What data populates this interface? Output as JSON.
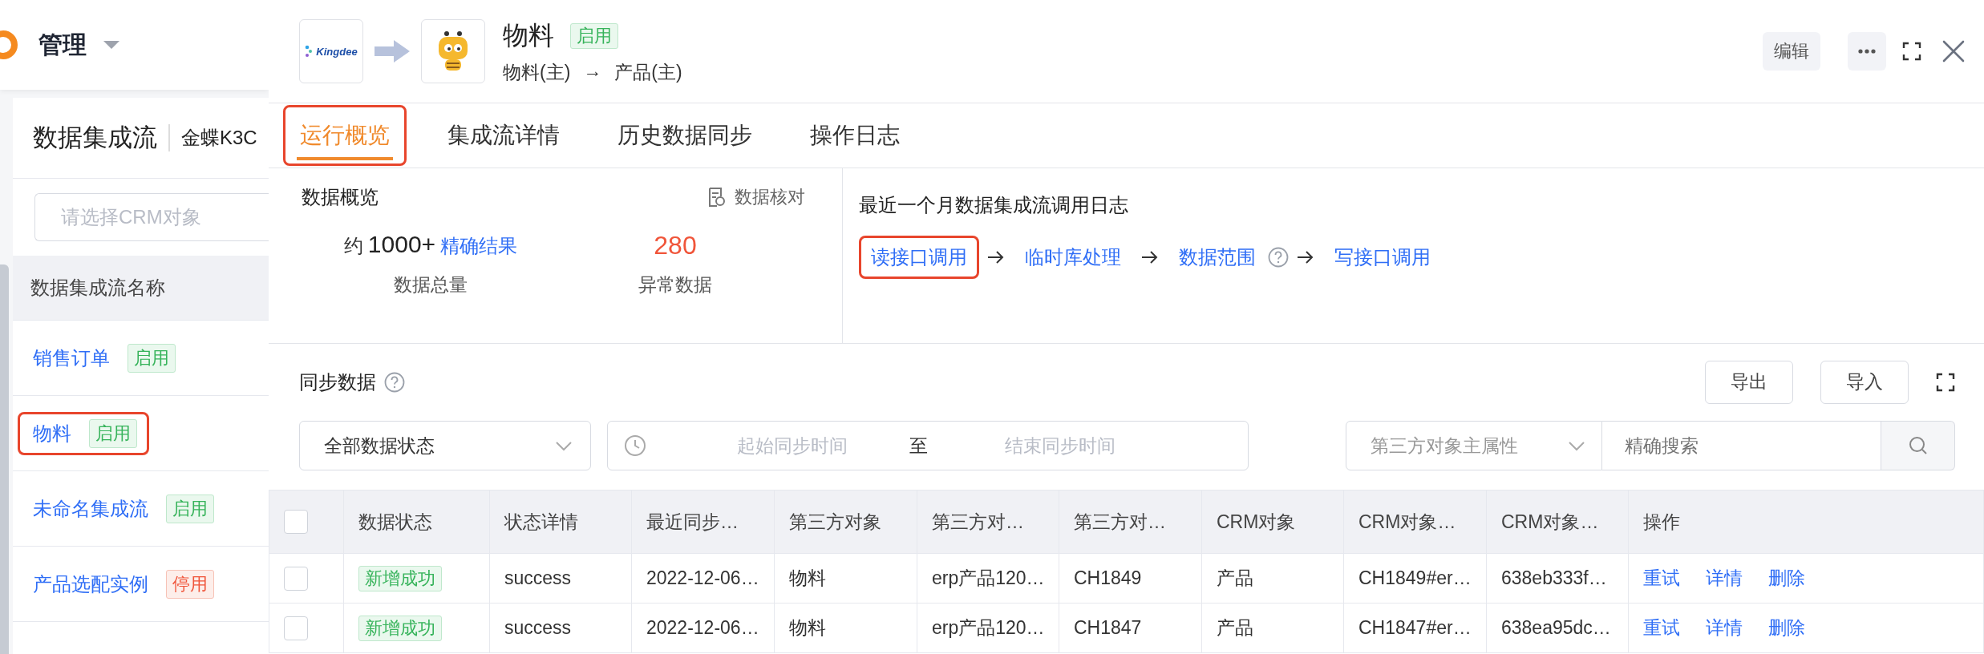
{
  "sidebar": {
    "app_title": "管理",
    "title": "数据集成流",
    "subtitle": "金蝶K3C",
    "search": {
      "placeholder": "请选择CRM对象"
    },
    "column": "数据集成流名称",
    "items": [
      {
        "name": "销售订单",
        "status": "启用",
        "enabled": true,
        "highlighted": false
      },
      {
        "name": "物料",
        "status": "启用",
        "enabled": true,
        "highlighted": true
      },
      {
        "name": "未命名集成流",
        "status": "启用",
        "enabled": true,
        "highlighted": false
      },
      {
        "name": "产品选配实例",
        "status": "停用",
        "enabled": false,
        "highlighted": false
      }
    ]
  },
  "drawer": {
    "source_logo": "Kingdee",
    "title": "物料",
    "status": "启用",
    "enabled": true,
    "source": "物料(主)",
    "arrow": "→",
    "target": "产品(主)",
    "edit_button": "编辑"
  },
  "tabs": [
    {
      "label": "运行概览",
      "selected": true,
      "highlighted": true
    },
    {
      "label": "集成流详情",
      "selected": false,
      "highlighted": false
    },
    {
      "label": "历史数据同步",
      "selected": false,
      "highlighted": false
    },
    {
      "label": "操作日志",
      "selected": false,
      "highlighted": false
    }
  ],
  "overview": {
    "title": "数据概览",
    "check_link": "数据核对",
    "total_prefix": "约",
    "total": "1000+",
    "exact_link": "精确结果",
    "total_label": "数据总量",
    "errors": "280",
    "errors_label": "异常数据"
  },
  "call_log": {
    "title": "最近一个月数据集成流调用日志",
    "steps": [
      {
        "label": "读接口调用",
        "highlighted": true,
        "help": false
      },
      {
        "label": "临时库处理",
        "highlighted": false,
        "help": false
      },
      {
        "label": "数据范围",
        "highlighted": false,
        "help": true
      },
      {
        "label": "写接口调用",
        "highlighted": false,
        "help": false
      }
    ]
  },
  "sync": {
    "title": "同步数据",
    "export_button": "导出",
    "import_button": "导入",
    "status_filter": "全部数据状态",
    "start_placeholder": "起始同步时间",
    "separator": "至",
    "end_placeholder": "结束同步时间",
    "attribute_select": "第三方对象主属性",
    "search_placeholder": "精确搜索"
  },
  "table": {
    "select_all_checked": false,
    "columns": [
      "",
      "数据状态",
      "状态详情",
      "最近同步…",
      "第三方对象",
      "第三方对…",
      "第三方对…",
      "CRM对象",
      "CRM对象…",
      "CRM对象…",
      "操作"
    ],
    "rows": [
      {
        "checked": false,
        "cells": [
          "",
          "新增成功",
          "success",
          "2022-12-06…",
          "物料",
          "erp产品120…",
          "CH1849",
          "产品",
          "CH1849#er…",
          "638eb333f…"
        ],
        "actions": [
          "重试",
          "详情",
          "删除"
        ]
      },
      {
        "checked": false,
        "cells": [
          "",
          "新增成功",
          "success",
          "2022-12-06…",
          "物料",
          "erp产品120…",
          "CH1847",
          "产品",
          "CH1847#er…",
          "638ea95dc…"
        ],
        "actions": [
          "重试",
          "详情",
          "删除"
        ]
      }
    ]
  }
}
